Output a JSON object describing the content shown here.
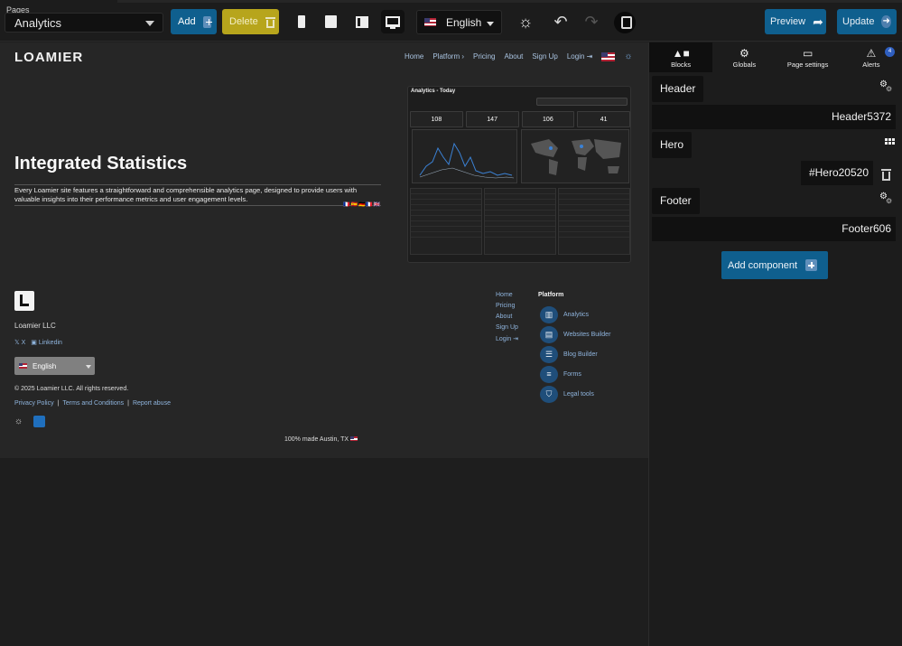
{
  "toolbar": {
    "pages_label": "Pages",
    "page_value": "Analytics",
    "add_label": "Add",
    "delete_label": "Delete",
    "language": "English",
    "preview_label": "Preview",
    "update_label": "Update",
    "icons": [
      "phone-icon",
      "tablet-icon",
      "laptop-icon",
      "desktop-icon",
      "sun-icon",
      "undo-icon",
      "redo-icon",
      "mascot-icon"
    ]
  },
  "site": {
    "logo": "LOAMIER",
    "nav": [
      "Home",
      "Platform",
      "Pricing",
      "About",
      "Sign Up",
      "Login"
    ],
    "hero_title": "Integrated Statistics",
    "hero_desc": "Every Loamier site features a straightforward and comprehensible analytics page, designed to provide users with valuable insights into their performance metrics and user engagement levels.",
    "shot": {
      "title": "Analytics - Today",
      "kpis": [
        "108",
        "147",
        "106",
        "41"
      ]
    },
    "footer": {
      "company": "Loamier LLC",
      "socials": [
        "X",
        "Linkedin"
      ],
      "language": "English",
      "copyright": "© 2025 Loamier LLC. All rights reserved.",
      "legal": [
        "Privacy Policy",
        "Terms and Conditions",
        "Report abuse"
      ],
      "nav": [
        "Home",
        "Pricing",
        "About",
        "Sign Up",
        "Login"
      ],
      "platform_title": "Platform",
      "platform_items": [
        {
          "label": "Analytics",
          "icon": "analytics-icon"
        },
        {
          "label": "Websites Builder",
          "icon": "website-icon"
        },
        {
          "label": "Blog Builder",
          "icon": "blog-icon"
        },
        {
          "label": "Forms",
          "icon": "forms-icon"
        },
        {
          "label": "Legal tools",
          "icon": "shield-icon"
        }
      ],
      "made_in": "100% made Austin, TX"
    }
  },
  "sidebar": {
    "tabs": [
      "Blocks",
      "Globals",
      "Page settings",
      "Alerts"
    ],
    "alerts_count": "4",
    "blocks": [
      {
        "title": "Header",
        "id": "Header5372"
      },
      {
        "title": "Hero",
        "id": "#Hero20520"
      },
      {
        "title": "Footer",
        "id": "Footer606"
      }
    ],
    "add_component": "Add component"
  },
  "colors": {
    "accent": "#0f5f8e",
    "delete": "#b7a51c",
    "link": "#8fb4dd"
  }
}
